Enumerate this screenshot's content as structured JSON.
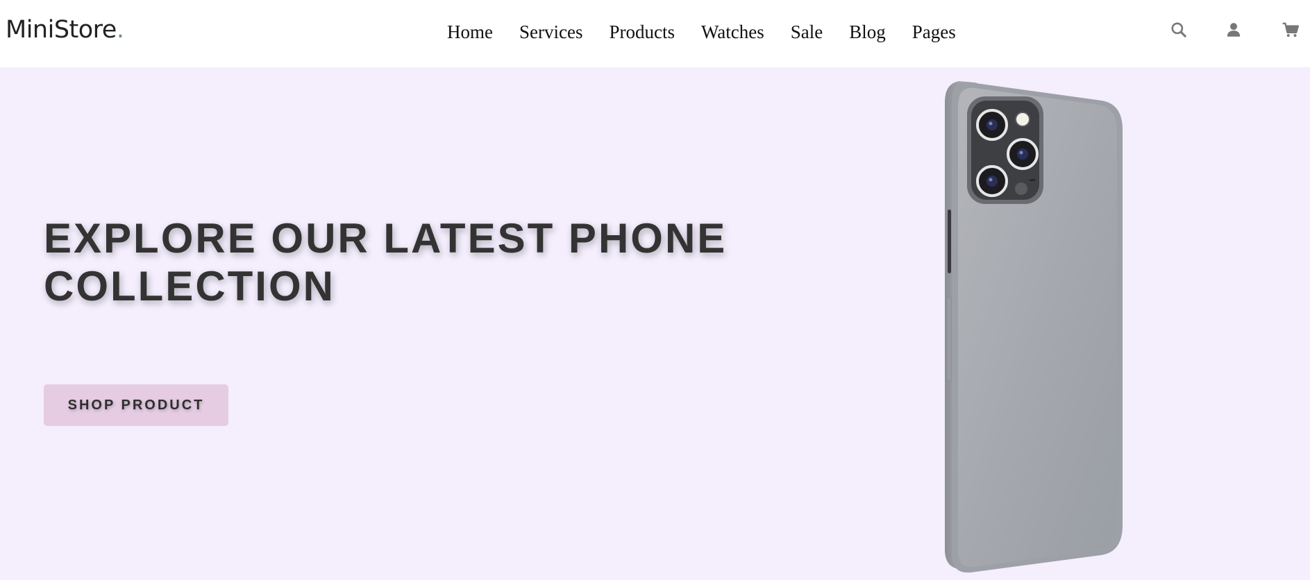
{
  "brand": {
    "name": "MiniStore",
    "dot": ".",
    "dot_color": "#6d8f98"
  },
  "nav": {
    "items": [
      "Home",
      "Services",
      "Products",
      "Watches",
      "Sale",
      "Blog",
      "Pages"
    ]
  },
  "header_icons": [
    "search-icon",
    "user-icon",
    "cart-icon"
  ],
  "hero": {
    "title": "EXPLORE OUR LATEST PHONE COLLECTION",
    "button_label": "SHOP PRODUCT",
    "product_image": "phone-image"
  },
  "colors": {
    "hero_background": "#f4eefd",
    "button_background": "#e5cce3",
    "title_color": "#333333",
    "icon_color": "#777777"
  }
}
